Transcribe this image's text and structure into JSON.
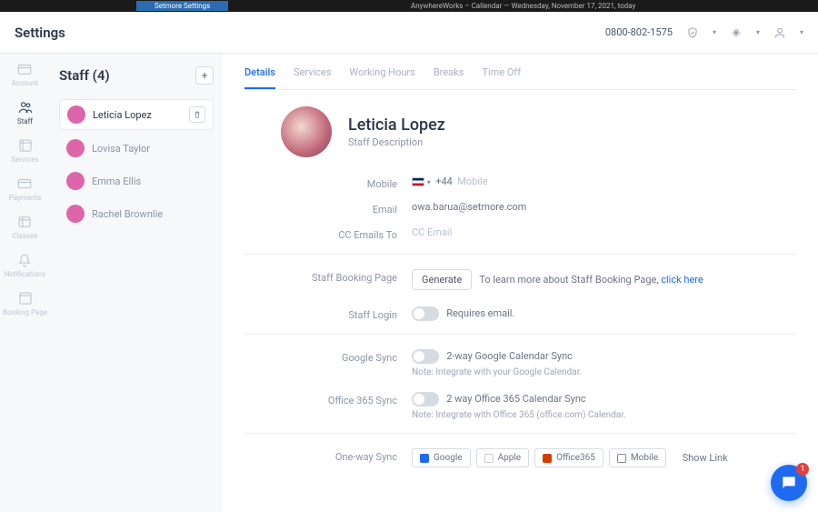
{
  "topbar": {
    "left_title": "Setmore Settings",
    "center_title": "AnywhereWorks – Callendar — Wednesday, November 17, 2021, today"
  },
  "header": {
    "title": "Settings",
    "phone": "0800-802-1575"
  },
  "nav": {
    "items": [
      {
        "id": "account",
        "label": "Account"
      },
      {
        "id": "staff",
        "label": "Staff"
      },
      {
        "id": "services",
        "label": "Services"
      },
      {
        "id": "payments",
        "label": "Payments"
      },
      {
        "id": "classes",
        "label": "Classes"
      },
      {
        "id": "notifications",
        "label": "Notifications"
      },
      {
        "id": "booking-page",
        "label": "Booking Page"
      }
    ]
  },
  "staff_panel": {
    "title": "Staff (4)",
    "items": [
      {
        "name": "Leticia Lopez",
        "selected": true
      },
      {
        "name": "Lovisa Taylor"
      },
      {
        "name": "Emma Ellis"
      },
      {
        "name": "Rachel Brownlie"
      }
    ]
  },
  "tabs": [
    "Details",
    "Services",
    "Working Hours",
    "Breaks",
    "Time Off"
  ],
  "profile": {
    "name": "Leticia Lopez",
    "subtitle": "Staff Description"
  },
  "contact": {
    "mobile_label": "Mobile",
    "mobile_prefix": "+44",
    "mobile_placeholder": "Mobile",
    "email_label": "Email",
    "email_value": "owa.barua@setmore.com",
    "cc_label": "CC Emails To",
    "cc_placeholder": "CC Email"
  },
  "booking": {
    "label": "Staff Booking Page",
    "button": "Generate",
    "hint_prefix": "To learn more about Staff Booking Page, ",
    "hint_link": "click here"
  },
  "login": {
    "label": "Staff Login",
    "toggle_text": "Off",
    "hint": "Requires email."
  },
  "google_sync": {
    "label": "Google Sync",
    "toggle_text": "Off",
    "caption": "2-way Google Calendar Sync",
    "note": "Note: Integrate with your Google Calendar."
  },
  "office_sync": {
    "label": "Office 365 Sync",
    "toggle_text": "Off",
    "caption": "2 way Office 365 Calendar Sync",
    "note": "Note: Integrate with Office 365 (office.com) Calendar."
  },
  "oneway": {
    "label": "One-way Sync",
    "options": [
      "Google",
      "Apple",
      "Office365",
      "Mobile"
    ],
    "show_link": "Show Link"
  },
  "chat_badge": "1"
}
